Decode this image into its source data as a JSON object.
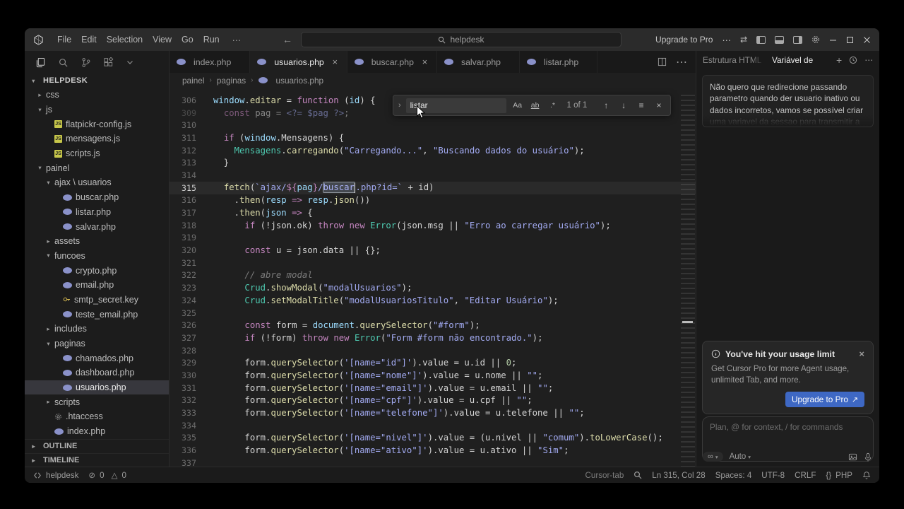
{
  "titlebar": {
    "menus": [
      "File",
      "Edit",
      "Selection",
      "View",
      "Go",
      "Run"
    ],
    "command_center": "helpdesk",
    "upgrade_label": "Upgrade to Pro"
  },
  "explorer": {
    "root": "HELPDESK",
    "items": [
      {
        "label": "css",
        "indent": 1,
        "kind": "folder",
        "expanded": false
      },
      {
        "label": "js",
        "indent": 1,
        "kind": "folder",
        "expanded": true
      },
      {
        "label": "flatpickr-config.js",
        "indent": 2,
        "kind": "js"
      },
      {
        "label": "mensagens.js",
        "indent": 2,
        "kind": "js"
      },
      {
        "label": "scripts.js",
        "indent": 2,
        "kind": "js"
      },
      {
        "label": "painel",
        "indent": 1,
        "kind": "folder",
        "expanded": true
      },
      {
        "label": "ajax \\ usuarios",
        "indent": 2,
        "kind": "folder",
        "expanded": true
      },
      {
        "label": "buscar.php",
        "indent": 3,
        "kind": "php"
      },
      {
        "label": "listar.php",
        "indent": 3,
        "kind": "php"
      },
      {
        "label": "salvar.php",
        "indent": 3,
        "kind": "php"
      },
      {
        "label": "assets",
        "indent": 2,
        "kind": "folder",
        "expanded": false
      },
      {
        "label": "funcoes",
        "indent": 2,
        "kind": "folder",
        "expanded": true
      },
      {
        "label": "crypto.php",
        "indent": 3,
        "kind": "php"
      },
      {
        "label": "email.php",
        "indent": 3,
        "kind": "php"
      },
      {
        "label": "smtp_secret.key",
        "indent": 3,
        "kind": "key"
      },
      {
        "label": "teste_email.php",
        "indent": 3,
        "kind": "php"
      },
      {
        "label": "includes",
        "indent": 2,
        "kind": "folder",
        "expanded": false
      },
      {
        "label": "paginas",
        "indent": 2,
        "kind": "folder",
        "expanded": true
      },
      {
        "label": "chamados.php",
        "indent": 3,
        "kind": "php"
      },
      {
        "label": "dashboard.php",
        "indent": 3,
        "kind": "php"
      },
      {
        "label": "usuarios.php",
        "indent": 3,
        "kind": "php",
        "selected": true
      },
      {
        "label": "scripts",
        "indent": 2,
        "kind": "folder",
        "expanded": false
      },
      {
        "label": ".htaccess",
        "indent": 2,
        "kind": "config"
      },
      {
        "label": "index.php",
        "indent": 2,
        "kind": "php"
      }
    ],
    "sections": [
      "OUTLINE",
      "TIMELINE"
    ]
  },
  "editor": {
    "tabs": [
      {
        "label": "index.php",
        "active": false,
        "close": false
      },
      {
        "label": "usuarios.php",
        "active": true,
        "close": true
      },
      {
        "label": "buscar.php",
        "active": false,
        "close": true
      },
      {
        "label": "salvar.php",
        "active": false,
        "close": false
      },
      {
        "label": "listar.php",
        "active": false,
        "close": false
      }
    ],
    "breadcrumb": [
      "painel",
      "paginas",
      "usuarios.php"
    ],
    "find": {
      "query": "listar",
      "count": "1 of 1",
      "case_label": "Aa",
      "word_label": "ab",
      "regex_label": ".*"
    },
    "lines": [
      {
        "n": "306",
        "s": [
          [
            "pr",
            "window"
          ],
          [
            "pl",
            "."
          ],
          [
            "fn",
            "editar"
          ],
          [
            "pl",
            " = "
          ],
          [
            "kw",
            "function"
          ],
          [
            "pl",
            " ("
          ],
          [
            "pr",
            "id"
          ],
          [
            "pl",
            ") {"
          ]
        ]
      },
      {
        "n": "309",
        "dim": true,
        "s": [
          [
            "pl",
            "  "
          ],
          [
            "kw",
            "const"
          ],
          [
            "pl",
            " pag = "
          ],
          [
            "st",
            "<?= $pag ?>"
          ],
          [
            "pl",
            ";"
          ]
        ]
      },
      {
        "n": "310",
        "s": []
      },
      {
        "n": "311",
        "s": [
          [
            "pl",
            "  "
          ],
          [
            "kw",
            "if"
          ],
          [
            "pl",
            " ("
          ],
          [
            "pr",
            "window"
          ],
          [
            "pl",
            ".Mensagens) {"
          ]
        ]
      },
      {
        "n": "312",
        "s": [
          [
            "pl",
            "    "
          ],
          [
            "cl",
            "Mensagens"
          ],
          [
            "pl",
            "."
          ],
          [
            "fn",
            "carregando"
          ],
          [
            "pl",
            "("
          ],
          [
            "st",
            "\"Carregando...\""
          ],
          [
            "pl",
            ", "
          ],
          [
            "st",
            "\"Buscando dados do usuário\""
          ],
          [
            "pl",
            ");"
          ]
        ]
      },
      {
        "n": "313",
        "s": [
          [
            "pl",
            "  }"
          ]
        ]
      },
      {
        "n": "314",
        "s": []
      },
      {
        "n": "315",
        "cur": true,
        "s": [
          [
            "pl",
            "  "
          ],
          [
            "fn",
            "fetch"
          ],
          [
            "pl",
            "("
          ],
          [
            "st",
            "`ajax/"
          ],
          [
            "kw",
            "${"
          ],
          [
            "pr",
            "pag"
          ],
          [
            "kw",
            "}"
          ],
          [
            "st",
            "/"
          ],
          [
            "mt",
            "buscar"
          ],
          [
            "caret",
            ""
          ],
          [
            "st",
            ".php?id=`"
          ],
          [
            "pl",
            " + id)"
          ]
        ]
      },
      {
        "n": "316",
        "s": [
          [
            "pl",
            "    ."
          ],
          [
            "fn",
            "then"
          ],
          [
            "pl",
            "("
          ],
          [
            "pr",
            "resp"
          ],
          [
            "pl",
            " "
          ],
          [
            "kw",
            "=>"
          ],
          [
            "pl",
            " "
          ],
          [
            "pr",
            "resp"
          ],
          [
            "pl",
            "."
          ],
          [
            "fn",
            "json"
          ],
          [
            "pl",
            "())"
          ]
        ]
      },
      {
        "n": "317",
        "s": [
          [
            "pl",
            "    ."
          ],
          [
            "fn",
            "then"
          ],
          [
            "pl",
            "("
          ],
          [
            "pr",
            "json"
          ],
          [
            "pl",
            " "
          ],
          [
            "kw",
            "=>"
          ],
          [
            "pl",
            " {"
          ]
        ]
      },
      {
        "n": "318",
        "s": [
          [
            "pl",
            "      "
          ],
          [
            "kw",
            "if"
          ],
          [
            "pl",
            " (!json.ok) "
          ],
          [
            "kw",
            "throw"
          ],
          [
            "pl",
            " "
          ],
          [
            "kw",
            "new"
          ],
          [
            "pl",
            " "
          ],
          [
            "cl",
            "Error"
          ],
          [
            "pl",
            "(json.msg || "
          ],
          [
            "st",
            "\"Erro ao carregar usuário\""
          ],
          [
            "pl",
            ");"
          ]
        ]
      },
      {
        "n": "319",
        "s": []
      },
      {
        "n": "320",
        "s": [
          [
            "pl",
            "      "
          ],
          [
            "kw",
            "const"
          ],
          [
            "pl",
            " u = json.data || {};"
          ]
        ]
      },
      {
        "n": "321",
        "s": []
      },
      {
        "n": "322",
        "s": [
          [
            "cm",
            "      // abre modal"
          ]
        ]
      },
      {
        "n": "323",
        "s": [
          [
            "pl",
            "      "
          ],
          [
            "cl",
            "Crud"
          ],
          [
            "pl",
            "."
          ],
          [
            "fn",
            "showModal"
          ],
          [
            "pl",
            "("
          ],
          [
            "st",
            "\"modalUsuarios\""
          ],
          [
            "pl",
            ");"
          ]
        ]
      },
      {
        "n": "324",
        "s": [
          [
            "pl",
            "      "
          ],
          [
            "cl",
            "Crud"
          ],
          [
            "pl",
            "."
          ],
          [
            "fn",
            "setModalTitle"
          ],
          [
            "pl",
            "("
          ],
          [
            "st",
            "\"modalUsuariosTitulo\""
          ],
          [
            "pl",
            ", "
          ],
          [
            "st",
            "\"Editar Usuário\""
          ],
          [
            "pl",
            ");"
          ]
        ]
      },
      {
        "n": "325",
        "s": []
      },
      {
        "n": "326",
        "s": [
          [
            "pl",
            "      "
          ],
          [
            "kw",
            "const"
          ],
          [
            "pl",
            " form = "
          ],
          [
            "pr",
            "document"
          ],
          [
            "pl",
            "."
          ],
          [
            "fn",
            "querySelector"
          ],
          [
            "pl",
            "("
          ],
          [
            "st",
            "\"#form\""
          ],
          [
            "pl",
            ");"
          ]
        ]
      },
      {
        "n": "327",
        "s": [
          [
            "pl",
            "      "
          ],
          [
            "kw",
            "if"
          ],
          [
            "pl",
            " (!form) "
          ],
          [
            "kw",
            "throw"
          ],
          [
            "pl",
            " "
          ],
          [
            "kw",
            "new"
          ],
          [
            "pl",
            " "
          ],
          [
            "cl",
            "Error"
          ],
          [
            "pl",
            "("
          ],
          [
            "st",
            "\"Form #form não encontrado.\""
          ],
          [
            "pl",
            ");"
          ]
        ]
      },
      {
        "n": "328",
        "s": []
      },
      {
        "n": "329",
        "s": [
          [
            "pl",
            "      form."
          ],
          [
            "fn",
            "querySelector"
          ],
          [
            "pl",
            "("
          ],
          [
            "st",
            "'[name=\"id\"]'"
          ],
          [
            "pl",
            ").value = u.id || "
          ],
          [
            "nu",
            "0"
          ],
          [
            "pl",
            ";"
          ]
        ]
      },
      {
        "n": "330",
        "s": [
          [
            "pl",
            "      form."
          ],
          [
            "fn",
            "querySelector"
          ],
          [
            "pl",
            "("
          ],
          [
            "st",
            "'[name=\"nome\"]'"
          ],
          [
            "pl",
            ").value = u.nome || "
          ],
          [
            "st",
            "\"\""
          ],
          [
            "pl",
            ";"
          ]
        ]
      },
      {
        "n": "331",
        "s": [
          [
            "pl",
            "      form."
          ],
          [
            "fn",
            "querySelector"
          ],
          [
            "pl",
            "("
          ],
          [
            "st",
            "'[name=\"email\"]'"
          ],
          [
            "pl",
            ").value = u.email || "
          ],
          [
            "st",
            "\"\""
          ],
          [
            "pl",
            ";"
          ]
        ]
      },
      {
        "n": "332",
        "s": [
          [
            "pl",
            "      form."
          ],
          [
            "fn",
            "querySelector"
          ],
          [
            "pl",
            "("
          ],
          [
            "st",
            "'[name=\"cpf\"]'"
          ],
          [
            "pl",
            ").value = u.cpf || "
          ],
          [
            "st",
            "\"\""
          ],
          [
            "pl",
            ";"
          ]
        ]
      },
      {
        "n": "333",
        "s": [
          [
            "pl",
            "      form."
          ],
          [
            "fn",
            "querySelector"
          ],
          [
            "pl",
            "("
          ],
          [
            "st",
            "'[name=\"telefone\"]'"
          ],
          [
            "pl",
            ").value = u.telefone || "
          ],
          [
            "st",
            "\"\""
          ],
          [
            "pl",
            ";"
          ]
        ]
      },
      {
        "n": "334",
        "s": []
      },
      {
        "n": "335",
        "s": [
          [
            "pl",
            "      form."
          ],
          [
            "fn",
            "querySelector"
          ],
          [
            "pl",
            "("
          ],
          [
            "st",
            "'[name=\"nivel\"]'"
          ],
          [
            "pl",
            ").value = (u.nivel || "
          ],
          [
            "st",
            "\"comum\""
          ],
          [
            "pl",
            ")."
          ],
          [
            "fn",
            "toLowerCase"
          ],
          [
            "pl",
            "();"
          ]
        ]
      },
      {
        "n": "336",
        "s": [
          [
            "pl",
            "      form."
          ],
          [
            "fn",
            "querySelector"
          ],
          [
            "pl",
            "("
          ],
          [
            "st",
            "'[name=\"ativo\"]'"
          ],
          [
            "pl",
            ").value = u.ativo || "
          ],
          [
            "st",
            "\"Sim\""
          ],
          [
            "pl",
            ";"
          ]
        ]
      },
      {
        "n": "337",
        "s": []
      }
    ]
  },
  "ai": {
    "tab_prev": "Estrutura HTML da",
    "tab_current": "Variável de",
    "message": "Não quero que redirecione passando parametro quando der usuario inativo ou dados incorretos, vamos se possível criar",
    "message_fade": "uma variavel da sessao para transmitir a",
    "usage_title": "You've hit your usage limit",
    "usage_body": "Get Cursor Pro for more Agent usage, unlimited Tab, and more.",
    "usage_button": "Upgrade to Pro",
    "input_placeholder": "Plan, @ for context, / for commands",
    "mode_symbol": "∞",
    "model": "Auto"
  },
  "statusbar": {
    "workspace": "helpdesk",
    "errors": "0",
    "warnings": "0",
    "tab_hint": "Cursor-tab",
    "position": "Ln 315, Col 28",
    "indent": "Spaces: 4",
    "encoding": "UTF-8",
    "eol": "CRLF",
    "language": "PHP"
  }
}
